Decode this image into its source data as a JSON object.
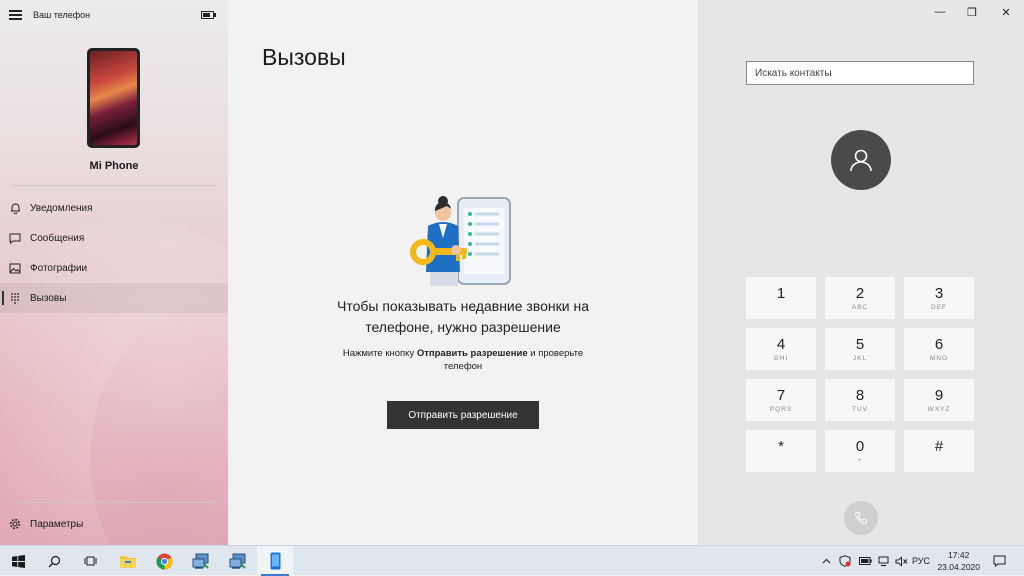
{
  "app": {
    "title": "Ваш телефон",
    "battery_level": 0.8
  },
  "device": {
    "name": "Mi Phone"
  },
  "nav": {
    "items": [
      {
        "label": "Уведомления",
        "icon": "bell-icon"
      },
      {
        "label": "Сообщения",
        "icon": "message-icon"
      },
      {
        "label": "Фотографии",
        "icon": "photo-icon"
      },
      {
        "label": "Вызовы",
        "icon": "dialpad-icon",
        "selected": true
      }
    ],
    "settings_label": "Параметры"
  },
  "main": {
    "title": "Вызовы",
    "headline_line1": "Чтобы показывать недавние звонки на",
    "headline_line2": "телефоне, нужно разрешение",
    "sub_pre": "Нажмите кнопку ",
    "sub_bold": "Отправить разрешение",
    "sub_post": " и проверьте телефон",
    "button_label": "Отправить разрешение"
  },
  "dialer": {
    "search_placeholder": "Искать контакты",
    "keys": [
      {
        "digit": "1",
        "letters": ""
      },
      {
        "digit": "2",
        "letters": "ABC"
      },
      {
        "digit": "3",
        "letters": "DEF"
      },
      {
        "digit": "4",
        "letters": "GHI"
      },
      {
        "digit": "5",
        "letters": "JKL"
      },
      {
        "digit": "6",
        "letters": "MNO"
      },
      {
        "digit": "7",
        "letters": "PQRS"
      },
      {
        "digit": "8",
        "letters": "TUV"
      },
      {
        "digit": "9",
        "letters": "WXYZ"
      },
      {
        "digit": "*",
        "letters": ""
      },
      {
        "digit": "0",
        "letters": "+"
      },
      {
        "digit": "#",
        "letters": ""
      }
    ]
  },
  "window_controls": {
    "minimize": "—",
    "maximize": "❐",
    "close": "✕"
  },
  "taskbar": {
    "language": "РУС",
    "time": "17:42",
    "date": "23.04.2020",
    "colors": {
      "accent": "#3a7bd5"
    }
  }
}
